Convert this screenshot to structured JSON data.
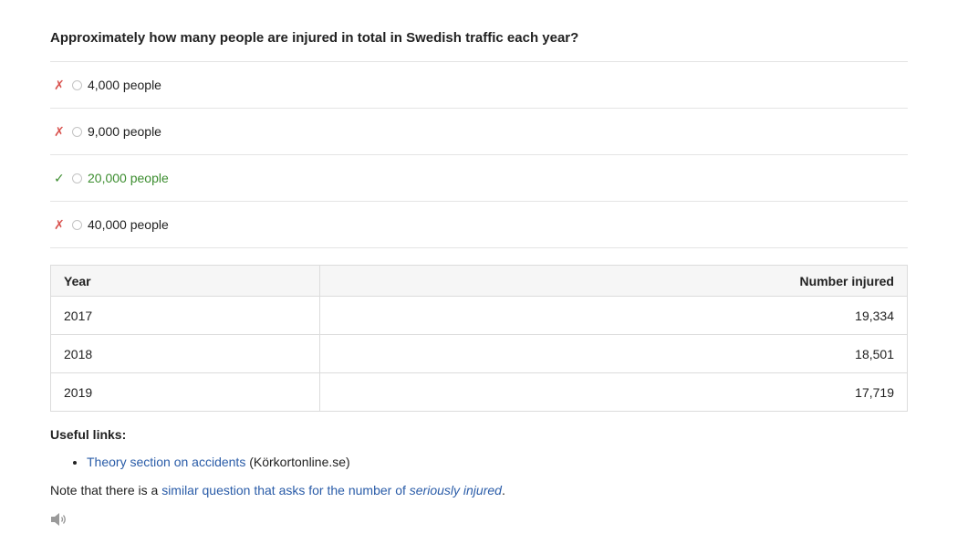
{
  "question": "Approximately how many people are injured in total in Swedish traffic each year?",
  "answers": [
    {
      "mark": "✗",
      "label": "4,000 people",
      "correct": false
    },
    {
      "mark": "✗",
      "label": "9,000 people",
      "correct": false
    },
    {
      "mark": "✓",
      "label": "20,000 people",
      "correct": true
    },
    {
      "mark": "✗",
      "label": "40,000 people",
      "correct": false
    }
  ],
  "table": {
    "headers": [
      "Year",
      "Number injured"
    ],
    "rows": [
      [
        "2017",
        "19,334"
      ],
      [
        "2018",
        "18,501"
      ],
      [
        "2019",
        "17,719"
      ]
    ]
  },
  "useful_links": {
    "title": "Useful links:",
    "items": [
      {
        "link_text": "Theory section on accidents",
        "suffix": " (Körkortonline.se)"
      }
    ]
  },
  "note": {
    "prefix": "Note that there is a ",
    "link_text": "similar question that asks for the number of ",
    "link_emphasis": "seriously injured",
    "suffix": "."
  },
  "colors": {
    "correct": "#3c8d2f",
    "wrong": "#d9534f",
    "link": "#2a5ca8"
  },
  "icons": {
    "correct_mark": "checkmark-icon",
    "wrong_mark": "cross-icon",
    "audio": "speaker-icon"
  }
}
